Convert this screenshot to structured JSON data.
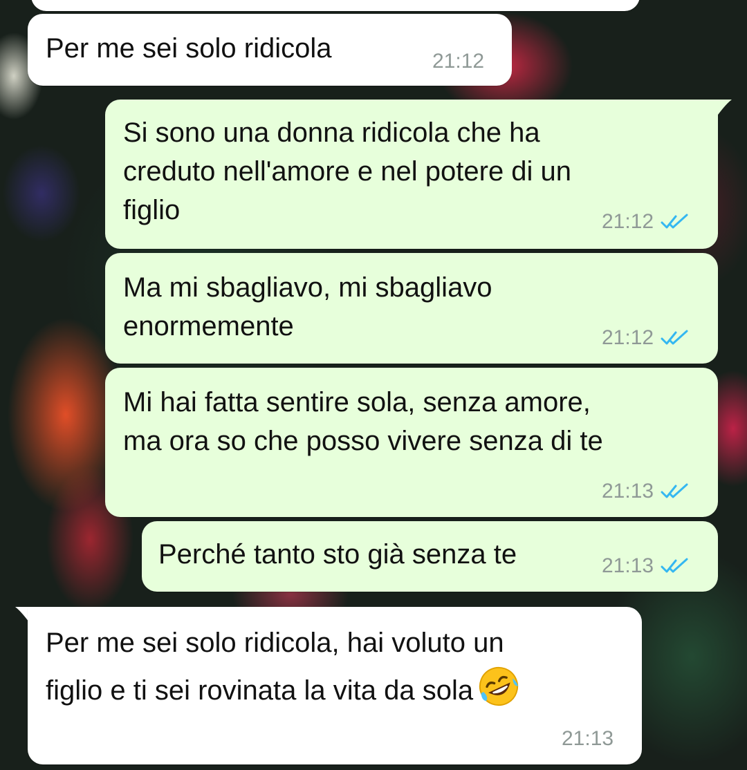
{
  "chat": {
    "messages": [
      {
        "direction": "incoming",
        "text": "",
        "time": ""
      },
      {
        "direction": "incoming",
        "text": "Per me sei solo ridicola",
        "time": "21:12"
      },
      {
        "direction": "outgoing",
        "text": "Si sono una donna ridicola che ha\ncreduto nell'amore e nel potere di un\nfiglio",
        "time": "21:12",
        "status": "read-double-check"
      },
      {
        "direction": "outgoing",
        "text": "Ma mi sbagliavo, mi sbagliavo\nenormemente",
        "time": "21:12",
        "status": "read-double-check"
      },
      {
        "direction": "outgoing",
        "text": "Mi hai fatta sentire sola, senza amore,\nma ora so che posso vivere senza di te",
        "time": "21:13",
        "status": "read-double-check"
      },
      {
        "direction": "outgoing",
        "text": "Perché tanto sto già senza te",
        "time": "21:13",
        "status": "read-double-check"
      },
      {
        "direction": "incoming",
        "text": "Per me sei solo ridicola, hai voluto un\nfiglio e ti sei rovinata la vita da sola",
        "emoji": "rolling-on-the-floor-laughing",
        "time": "21:13"
      }
    ]
  },
  "colors": {
    "incoming_bubble": "#ffffff",
    "outgoing_bubble": "#e7ffdb",
    "timestamp": "#8f9996",
    "read_ticks": "#34b7f1"
  }
}
